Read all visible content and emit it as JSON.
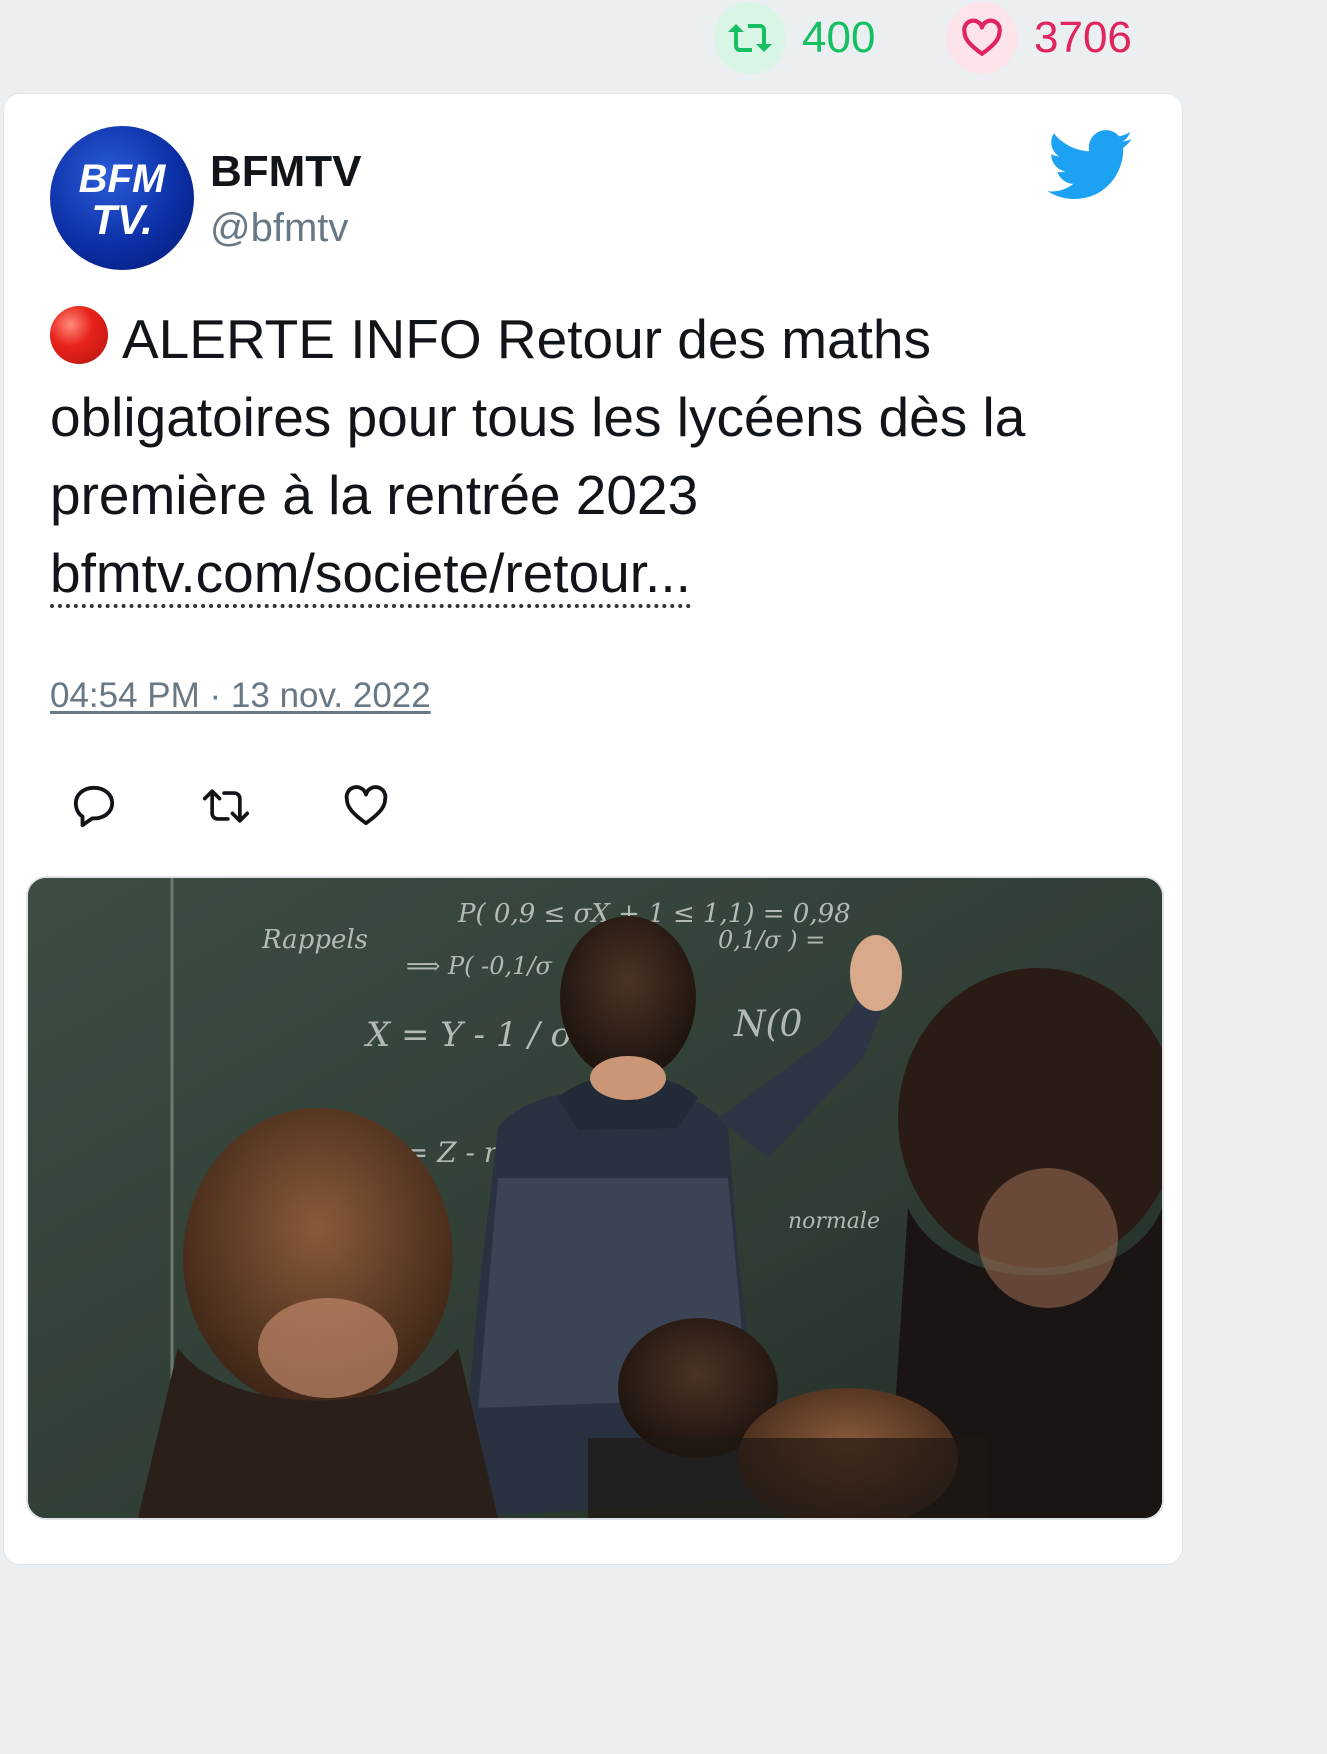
{
  "stats": {
    "retweets": {
      "count": "400",
      "icon": "retweet-icon",
      "color": "#17bf63"
    },
    "likes": {
      "count": "3706",
      "icon": "heart-icon",
      "color": "#e0245e"
    }
  },
  "tweet": {
    "author": {
      "display_name": "BFMTV",
      "handle": "@bfmtv",
      "avatar": {
        "line1": "BFM",
        "line2": "TV."
      }
    },
    "text": "ALERTE INFO Retour des maths obligatoires pour tous les lycéens dès la première à la rentrée 2023",
    "link": "bfmtv.com/societe/retour...",
    "timestamp": "04:54 PM · 13 nov. 2022",
    "actions": [
      {
        "name": "reply",
        "icon": "reply-icon"
      },
      {
        "name": "retweet",
        "icon": "retweet-icon"
      },
      {
        "name": "like",
        "icon": "heart-icon"
      }
    ],
    "media": {
      "chalkboard_lines": [
        "P( 0,9 ≤ σX + 1 ≤ 1,1) = 0,98",
        "Rappels",
        "⟹ P( -0,1/σ",
        "0,1/σ ) =",
        "X = Y - 1 / σ",
        "N(0",
        "en limite :  X = Z - np / √np",
        "normale"
      ]
    }
  },
  "brand": {
    "twitter_blue": "#1da1f2",
    "bfm_blue": "#0c2fa6"
  }
}
